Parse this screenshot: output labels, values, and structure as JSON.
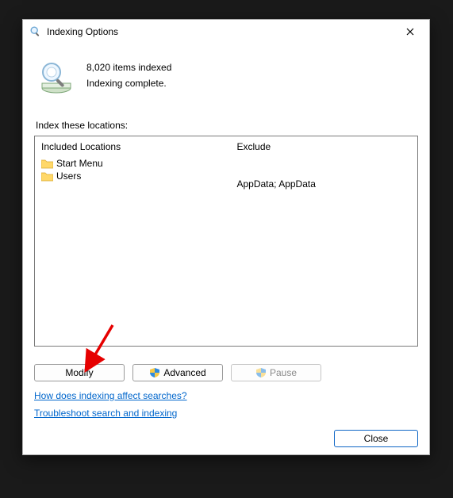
{
  "window": {
    "title": "Indexing Options"
  },
  "status": {
    "count_line": "8,020 items indexed",
    "state_line": "Indexing complete."
  },
  "locations_label": "Index these locations:",
  "columns": {
    "included_header": "Included Locations",
    "exclude_header": "Exclude"
  },
  "locations": [
    {
      "name": "Start Menu",
      "exclude": ""
    },
    {
      "name": "Users",
      "exclude": "AppData; AppData"
    }
  ],
  "buttons": {
    "modify": "Modify",
    "advanced": "Advanced",
    "pause": "Pause",
    "close": "Close"
  },
  "links": {
    "help": "How does indexing affect searches?",
    "troubleshoot": "Troubleshoot search and indexing"
  }
}
